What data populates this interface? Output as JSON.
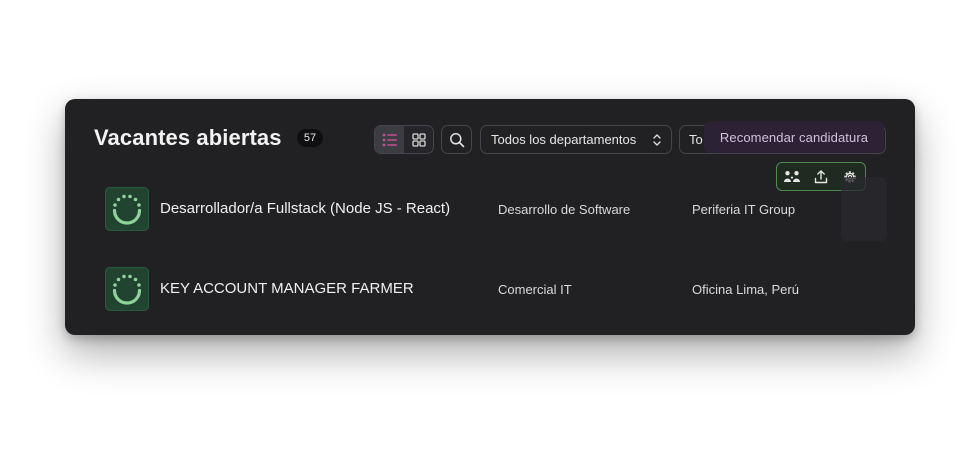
{
  "header": {
    "title": "Vacantes abiertas",
    "count": "57"
  },
  "toolbar": {
    "view_list_icon": "list-icon",
    "view_grid_icon": "grid-icon",
    "search_icon": "search-icon",
    "department_select": "Todos los departamentos",
    "second_select": "To"
  },
  "tooltip": {
    "text": "Recomendar candidatura"
  },
  "actions": [
    {
      "icon": "recommend-people-icon"
    },
    {
      "icon": "upload-icon"
    },
    {
      "icon": "gear-icon"
    }
  ],
  "jobs": [
    {
      "title": "Desarrollador/a Fullstack (Node JS - React)",
      "department": "Desarrollo de Software",
      "location": "Periferia IT Group"
    },
    {
      "title": "KEY ACCOUNT MANAGER FARMER",
      "department": "Comercial IT",
      "location": "Oficina Lima, Perú"
    }
  ],
  "colors": {
    "panel_bg": "#212124",
    "accent_pink": "#c0508f",
    "accent_green": "#4f8a4f",
    "logo_green": "#8fd29a",
    "tooltip_bg": "#2c2135"
  }
}
